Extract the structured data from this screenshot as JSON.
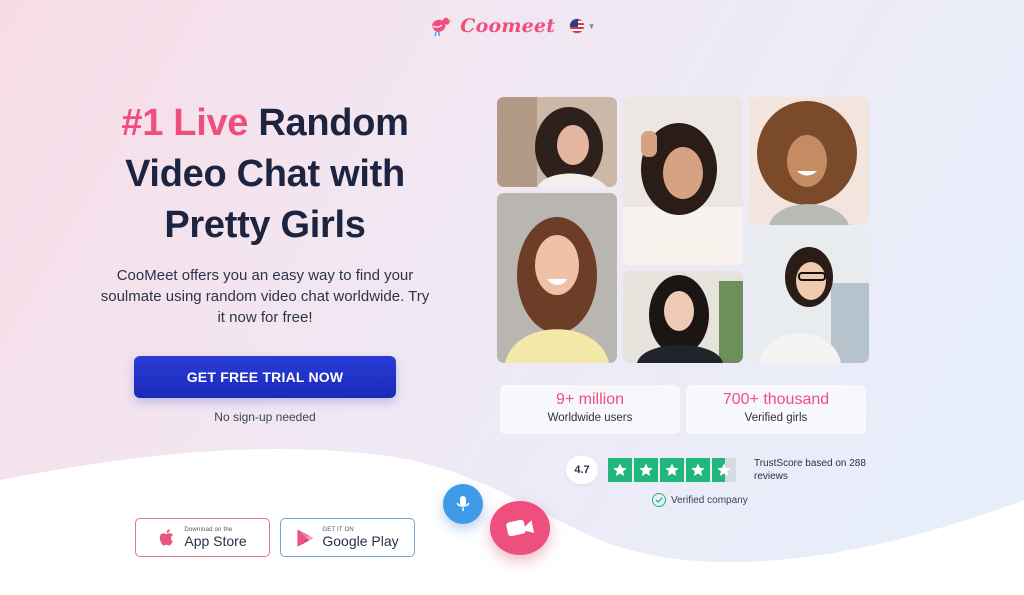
{
  "brand": {
    "name": "Coomeet",
    "accent": "#ef4f7d"
  },
  "header": {
    "language_icon": "us-flag-icon"
  },
  "hero": {
    "title_accent": "#1 Live",
    "title_rest_1": "Random",
    "title_rest_2": "Video Chat with",
    "title_rest_3": "Pretty Girls",
    "description": "CooMeet offers you an easy way to find your soulmate using random video chat worldwide. Try it now for free!",
    "cta_label": "GET FREE TRIAL NOW",
    "cta_color": "#1f31c8",
    "note": "No sign-up needed"
  },
  "stores": {
    "apple": {
      "small": "Download on the",
      "big": "App Store"
    },
    "google": {
      "small": "GET IT ON",
      "big": "Google Play"
    }
  },
  "stats": [
    {
      "value": "9+ million",
      "label": "Worldwide users"
    },
    {
      "value": "700+ thousand",
      "label": "Verified girls"
    }
  ],
  "trust": {
    "score": "4.7",
    "stars": 4.5,
    "text": "TrustScore based on 288 reviews",
    "verified": "Verified company",
    "star_color": "#20b77a"
  },
  "floating": {
    "mic_icon": "microphone-icon",
    "camera_icon": "video-camera-icon"
  }
}
